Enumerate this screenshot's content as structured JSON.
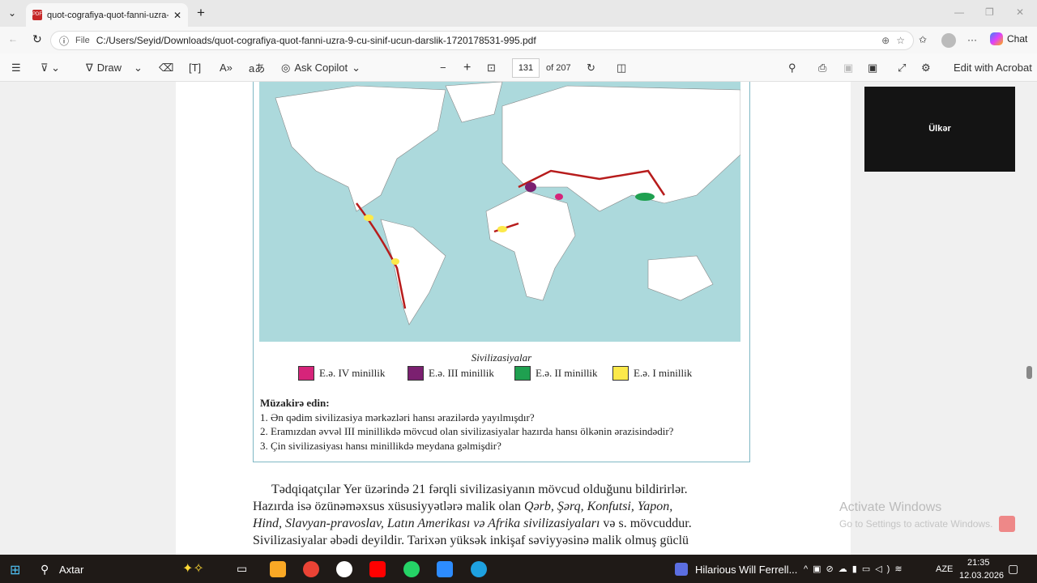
{
  "browser": {
    "tab_title": "quot-cografiya-quot-fanni-uzra-9-",
    "file_label": "File",
    "url": "C:/Users/Seyid/Downloads/quot-cografiya-quot-fanni-uzra-9-cu-sinif-ucun-darslik-1720178531-995.pdf",
    "chat_label": "Chat"
  },
  "pdf_toolbar": {
    "draw_label": "Draw",
    "ask_copilot_label": "Ask Copilot",
    "current_page": "131",
    "total_pages": "of 207",
    "edit_acrobat_label": "Edit with Acrobat"
  },
  "figure": {
    "legend_title": "Sivilizasiyalar",
    "legend": [
      {
        "label": "E.ə. IV minillik",
        "color": "#d6247a"
      },
      {
        "label": "E.ə. III minillik",
        "color": "#7b2070"
      },
      {
        "label": "E.ə. II minillik",
        "color": "#1fa050"
      },
      {
        "label": "E.ə. I minillik",
        "color": "#fce94a"
      }
    ],
    "discussion_title": "Müzakirə edin:",
    "questions": [
      "1. Ən qədim sivilizasiya mərkəzləri hansı ərazilərdə yayılmışdır?",
      "2. Eramızdan əvvəl III minillikdə mövcud olan sivilizasiyalar hazırda hansı ölkənin ərazisindədir?",
      "3. Çin sivilizasiyası hansı minillikdə meydana gəlmişdir?"
    ]
  },
  "body": {
    "line1": "Tədqiqatçılar Yer üzərində 21 fərqli sivilizasiyanın mövcud olduğunu bildirirlər.",
    "line2_a": "Hazırda isə özünəməxsus xüsusiyyətlərə malik olan ",
    "line2_b": "Qərb, Şərq, Konfutsi, Yapon,",
    "line3_a": "Hind, Slavyan-pravoslav, Latın Amerikası və Afrika sivilizasiyaları",
    "line3_b": " və s. mövcuddur.",
    "line4": "Sivilizasiyalar əbədi deyildir. Tarixən yüksək inkişaf səviyyəsinə malik olmuş güclü"
  },
  "video": {
    "name": "Ülkər"
  },
  "watermark": {
    "title": "Activate Windows",
    "subtitle": "Go to Settings to activate Windows."
  },
  "taskbar": {
    "search_label": "Axtar",
    "media_title": "Hilarious Will Ferrell...",
    "language": "AZE",
    "time": "21:35",
    "date": "12.03.2026"
  }
}
